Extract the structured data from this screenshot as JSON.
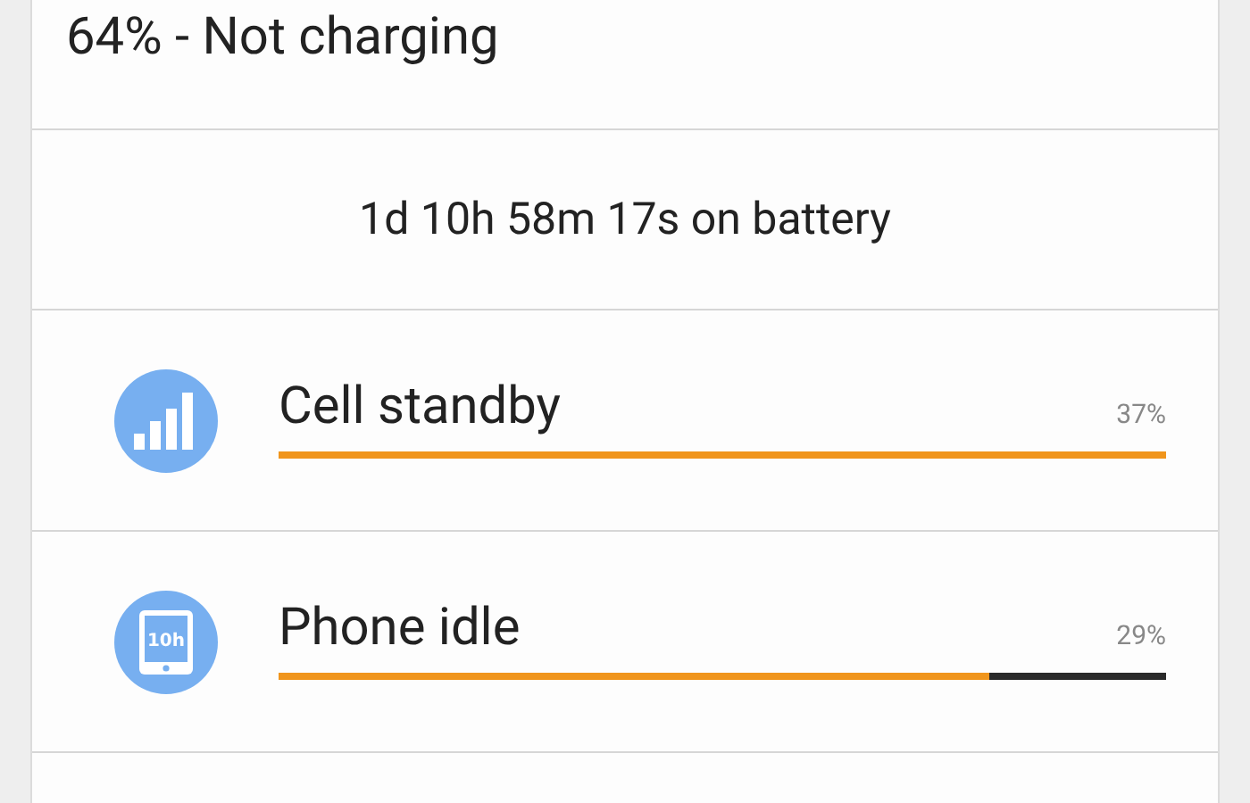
{
  "status": "64% - Not charging",
  "time_on_battery": "1d 10h 58m 17s on battery",
  "items": [
    {
      "kind": "signal",
      "label": "Cell standby",
      "percent": "37%",
      "level": 1.0
    },
    {
      "kind": "phone",
      "icon_text": "10h",
      "label": "Phone idle",
      "percent": "29%",
      "level": 0.8
    }
  ]
}
